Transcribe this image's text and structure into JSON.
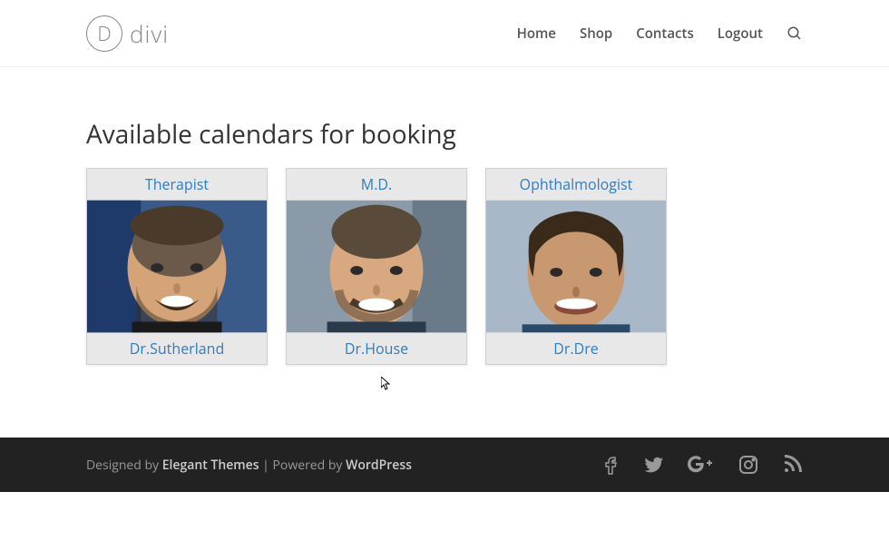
{
  "logo": {
    "letter": "D",
    "text": "divi"
  },
  "nav": {
    "home": "Home",
    "shop": "Shop",
    "contacts": "Contacts",
    "logout": "Logout"
  },
  "heading": "Available calendars for booking",
  "cards": [
    {
      "role": "Therapist",
      "name": "Dr.Sutherland"
    },
    {
      "role": "M.D.",
      "name": "Dr.House"
    },
    {
      "role": "Ophthalmologist",
      "name": "Dr.Dre"
    }
  ],
  "footer": {
    "designed": "Designed by ",
    "theme": "Elegant Themes",
    "mid": " | Powered by ",
    "wp": "WordPress"
  }
}
